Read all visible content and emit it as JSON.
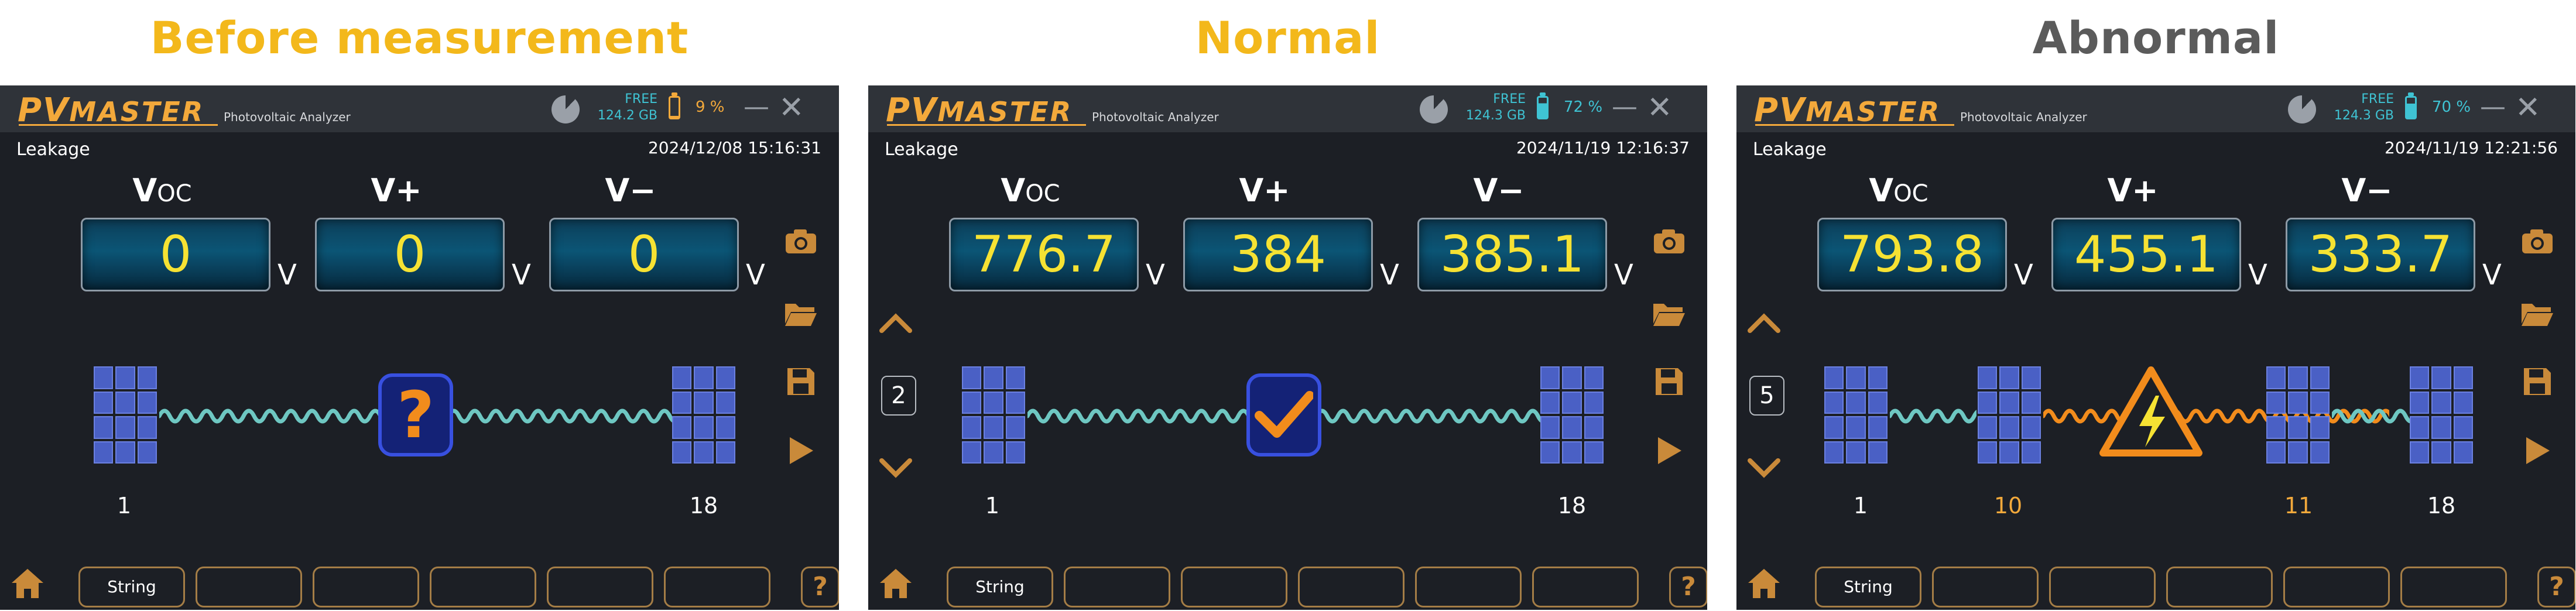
{
  "captions": [
    "Before measurement",
    "Normal",
    "Abnormal"
  ],
  "caption_colors": [
    "#f3b81b",
    "#f3b81b",
    "#5b5b5b"
  ],
  "app": {
    "logo_pv": "PV",
    "logo_master": "MASTER",
    "subtitle": "Photovoltaic Analyzer",
    "mode": "Leakage",
    "free_label": "FREE"
  },
  "labels": {
    "voc_main": "V",
    "voc_sub": "OC",
    "vplus": "V+",
    "vminus": "V−",
    "unit": "V"
  },
  "tab_string_label": "String",
  "screens": [
    {
      "storage": "124.2 GB",
      "battery_pct": "9 %",
      "battery_level": 0.09,
      "battery_color": "#f3a93b",
      "timestamp": "2024/12/08 15:16:31",
      "voc": "0",
      "vplus": "0",
      "vminus": "0",
      "string_number": "",
      "status": "unknown",
      "status_icon": "question-icon",
      "string_labels": [
        "1",
        "18"
      ]
    },
    {
      "storage": "124.3 GB",
      "battery_pct": "72 %",
      "battery_level": 0.72,
      "battery_color": "#3fc3d3",
      "timestamp": "2024/11/19 12:16:37",
      "voc": "776.7",
      "vplus": "384",
      "vminus": "385.1",
      "string_number": "2",
      "status": "normal",
      "status_icon": "checkmark-icon",
      "string_labels": [
        "1",
        "18"
      ]
    },
    {
      "storage": "124.3 GB",
      "battery_pct": "70 %",
      "battery_level": 0.7,
      "battery_color": "#3fc3d3",
      "timestamp": "2024/11/19 12:21:56",
      "voc": "793.8",
      "vplus": "455.1",
      "vminus": "333.7",
      "string_number": "5",
      "status": "abnormal",
      "status_icon": "warning-lightning-icon",
      "string_labels": [
        "1",
        "10",
        "11",
        "18"
      ]
    }
  ],
  "colors": {
    "accent": "#c98a3a",
    "value_yellow": "#f6e233",
    "wire_normal": "#6ec7c2",
    "wire_fault": "#f28c1c",
    "fault_label": "#f3a93b"
  }
}
